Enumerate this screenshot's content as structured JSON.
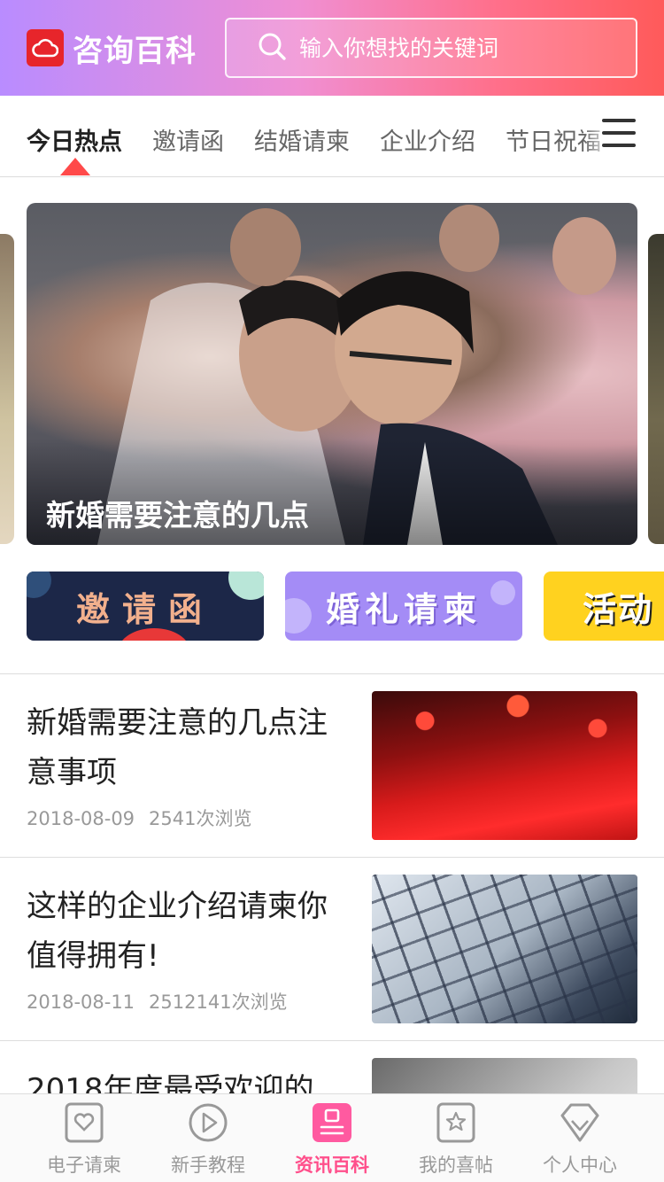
{
  "header": {
    "brand": "咨询百科",
    "search_placeholder": "输入你想找的关键词"
  },
  "tabs": [
    {
      "label": "今日热点",
      "active": true
    },
    {
      "label": "邀请函"
    },
    {
      "label": "结婚请柬"
    },
    {
      "label": "企业介绍"
    },
    {
      "label": "节日祝福"
    }
  ],
  "banner": {
    "caption": "新婚需要注意的几点"
  },
  "categories": [
    {
      "label": "邀请函",
      "color": "#1c2748"
    },
    {
      "label": "婚礼请柬",
      "color": "#a48cf6"
    },
    {
      "label": "活动",
      "color": "#ffd21f"
    }
  ],
  "articles": [
    {
      "title": "新婚需要注意的几点注意事项",
      "date": "2018-08-09",
      "views": "2541次浏览"
    },
    {
      "title": "这样的企业介绍请柬你值得拥有!",
      "date": "2018-08-11",
      "views": "2512141次浏览"
    },
    {
      "title": "2018年度最受欢迎的"
    }
  ],
  "nav": [
    {
      "label": "电子请柬",
      "icon": "heart-card-icon"
    },
    {
      "label": "新手教程",
      "icon": "play-icon"
    },
    {
      "label": "资讯百科",
      "icon": "news-icon",
      "active": true
    },
    {
      "label": "我的喜帖",
      "icon": "star-card-icon"
    },
    {
      "label": "个人中心",
      "icon": "diamond-icon"
    }
  ],
  "colors": {
    "accent": "#ff4f8b",
    "tab_indicator": "#ff4a4a",
    "logo": "#e7252b"
  }
}
